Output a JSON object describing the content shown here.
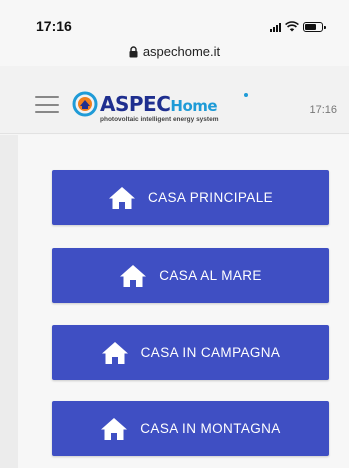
{
  "status_bar": {
    "time": "17:16",
    "signal_icon": "signal-bars-icon",
    "wifi_icon": "wifi-icon",
    "battery_icon": "battery-icon"
  },
  "browser": {
    "url": "aspechome.it",
    "secure_icon": "lock-icon"
  },
  "header": {
    "menu_icon": "hamburger-menu-icon",
    "logo": {
      "brand_main": "ASPEC",
      "brand_sub": "Home",
      "tagline": "photovoltaic intelligent energy system"
    },
    "time": "17:16"
  },
  "houses": [
    {
      "label": "CASA PRINCIPALE",
      "icon": "house-icon"
    },
    {
      "label": "CASA AL MARE",
      "icon": "house-icon"
    },
    {
      "label": "CASA IN CAMPAGNA",
      "icon": "house-icon"
    },
    {
      "label": "CASA IN MONTAGNA",
      "icon": "house-icon"
    }
  ],
  "colors": {
    "button_bg": "#3f4fc3",
    "button_text": "#ffffff",
    "brand_dark_blue": "#1f2f8f",
    "brand_light_blue": "#1f9bd7"
  }
}
